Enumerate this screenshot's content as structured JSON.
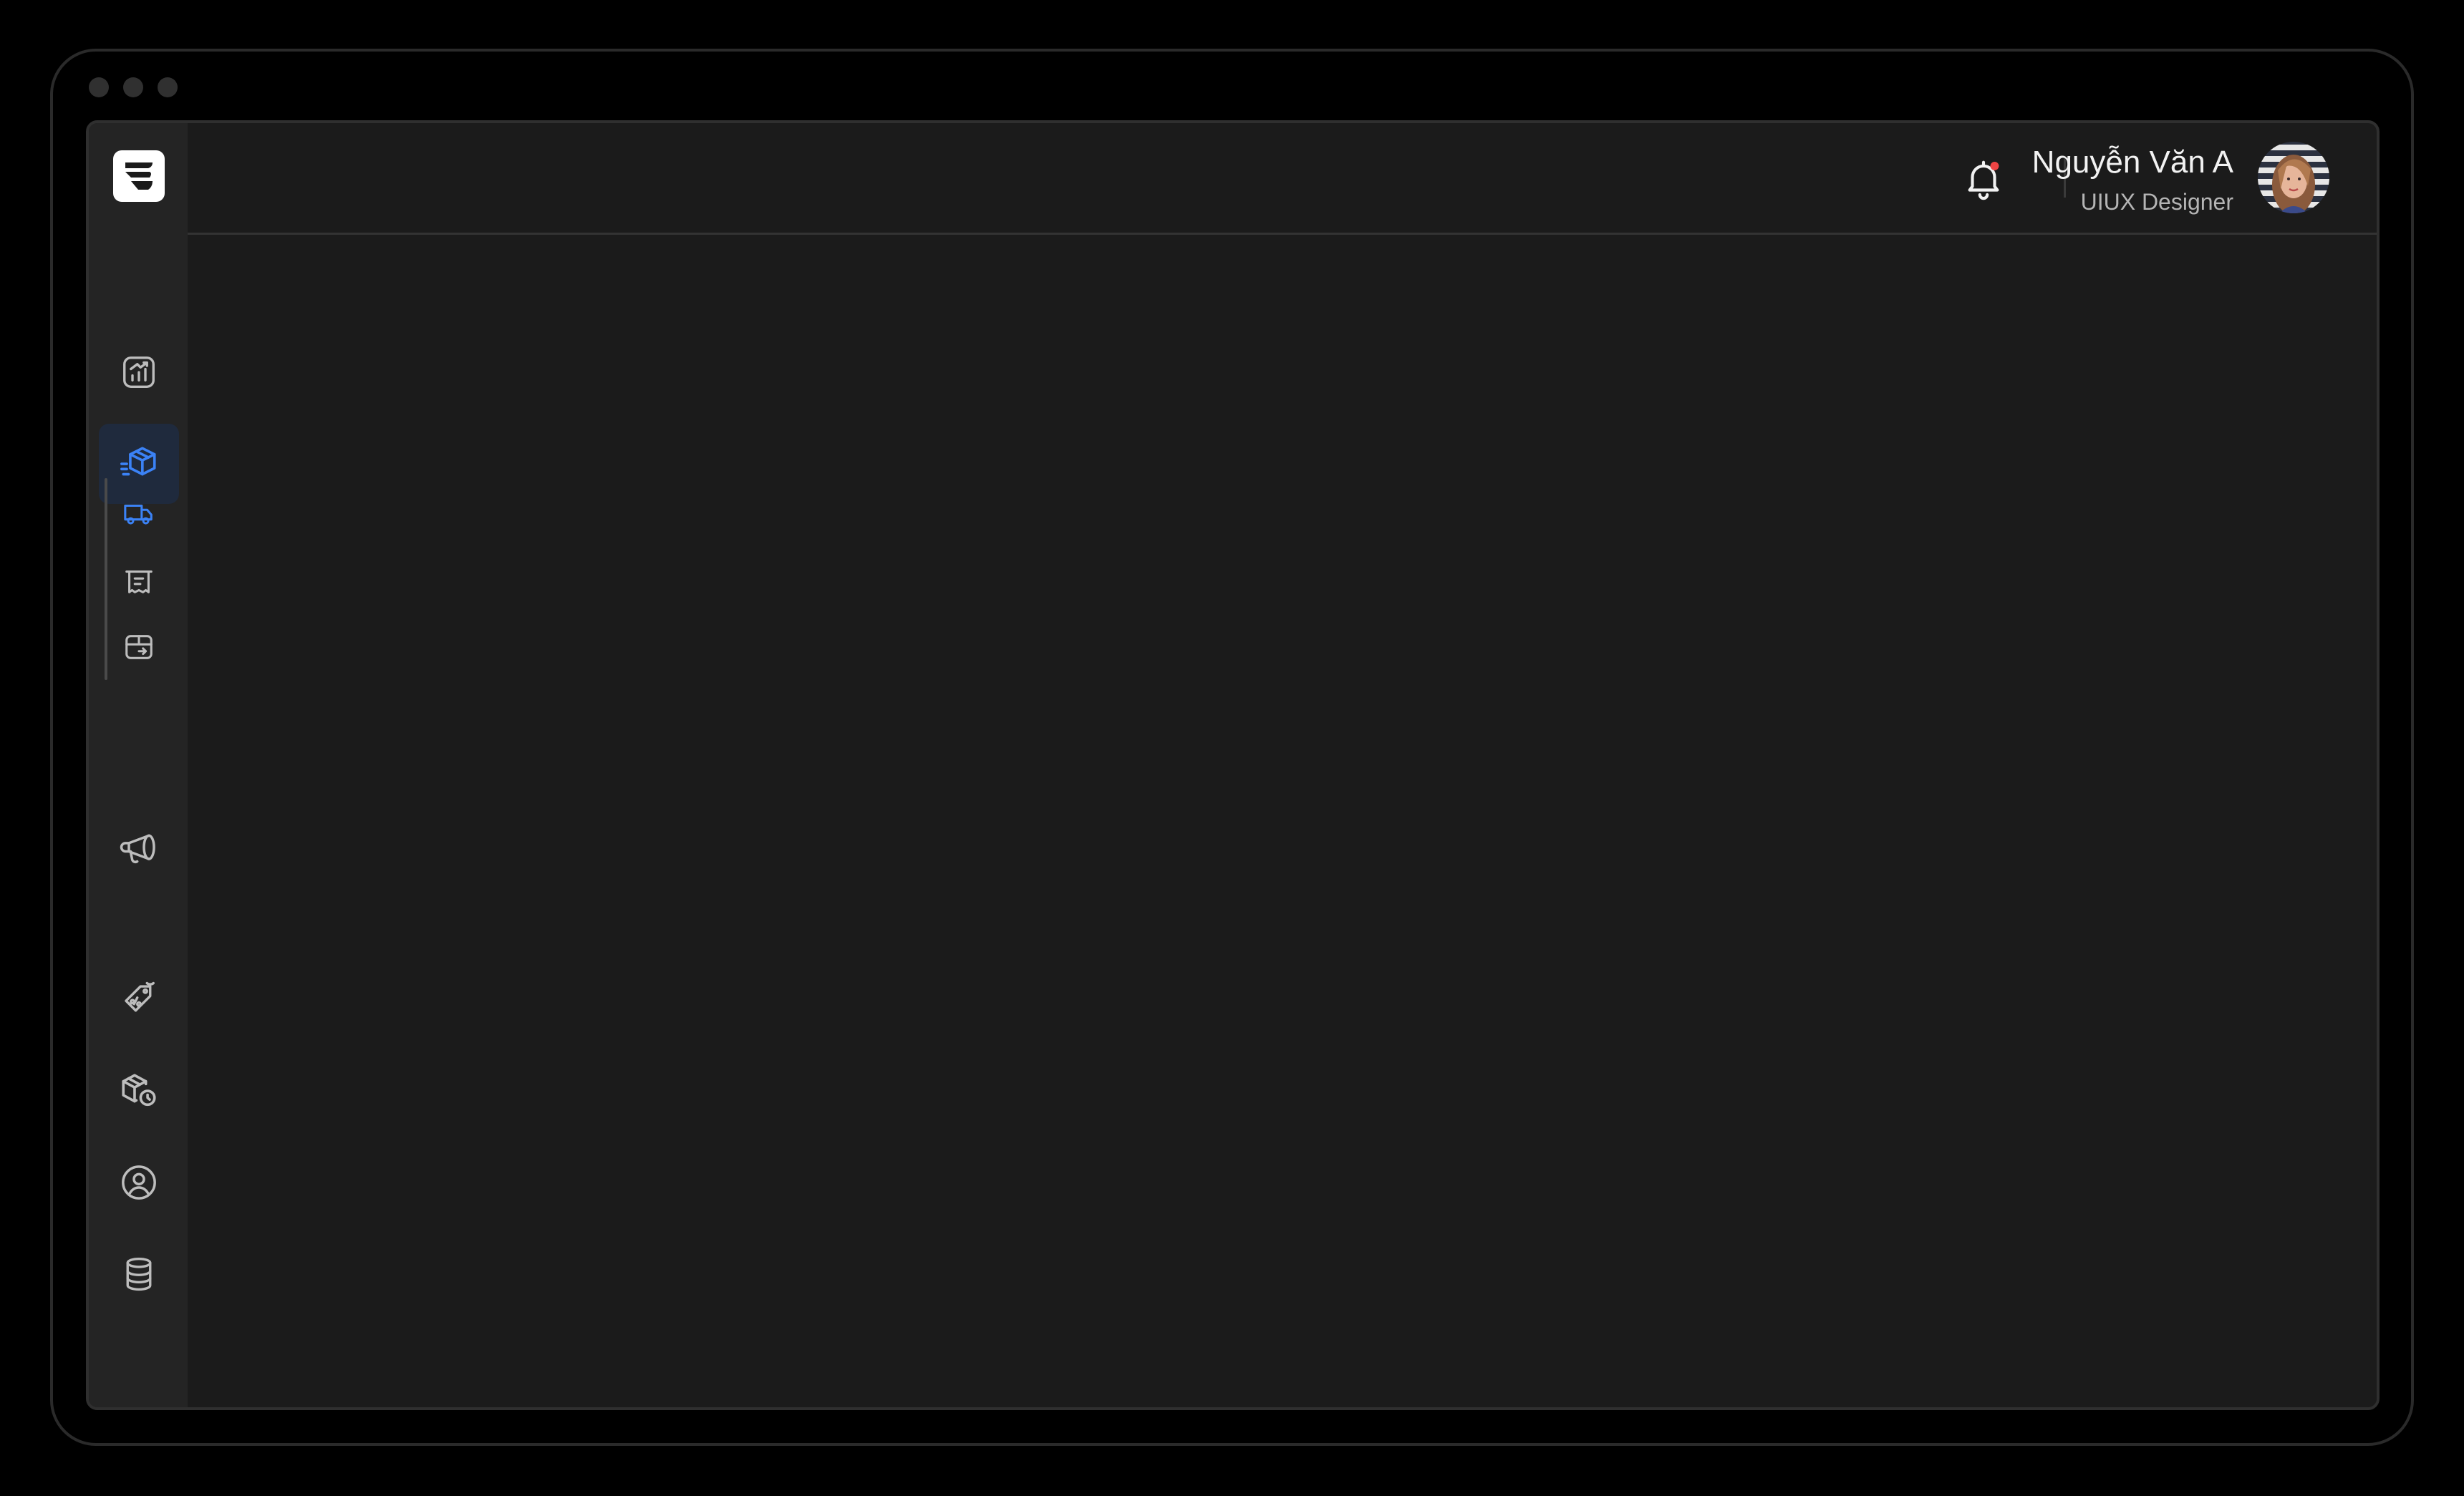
{
  "window": {
    "traffic_lights": [
      "close",
      "minimize",
      "maximize"
    ]
  },
  "sidebar": {
    "logo_icon": "brand-logo-icon",
    "items": [
      {
        "icon": "analytics-chart-icon",
        "active": false
      },
      {
        "icon": "box-delivery-icon",
        "active": true,
        "subitems": [
          {
            "icon": "truck-icon",
            "active": true
          },
          {
            "icon": "receipt-icon",
            "active": false
          },
          {
            "icon": "box-return-icon",
            "active": false
          }
        ]
      },
      {
        "icon": "megaphone-icon",
        "active": false
      },
      {
        "icon": "price-tag-icon",
        "active": false
      },
      {
        "icon": "box-clock-icon",
        "active": false
      },
      {
        "icon": "user-circle-icon",
        "active": false
      },
      {
        "icon": "database-icon",
        "active": false
      }
    ]
  },
  "header": {
    "notification_icon": "bell-icon",
    "has_unread": true,
    "user": {
      "name": "Nguyễn Văn A",
      "role": "UIUX Designer"
    }
  },
  "colors": {
    "accent": "#3b82f6",
    "notification_dot": "#ef4444",
    "background": "#1b1b1b",
    "sidebar": "#242424",
    "active_item_bg": "#1f2a3d"
  }
}
